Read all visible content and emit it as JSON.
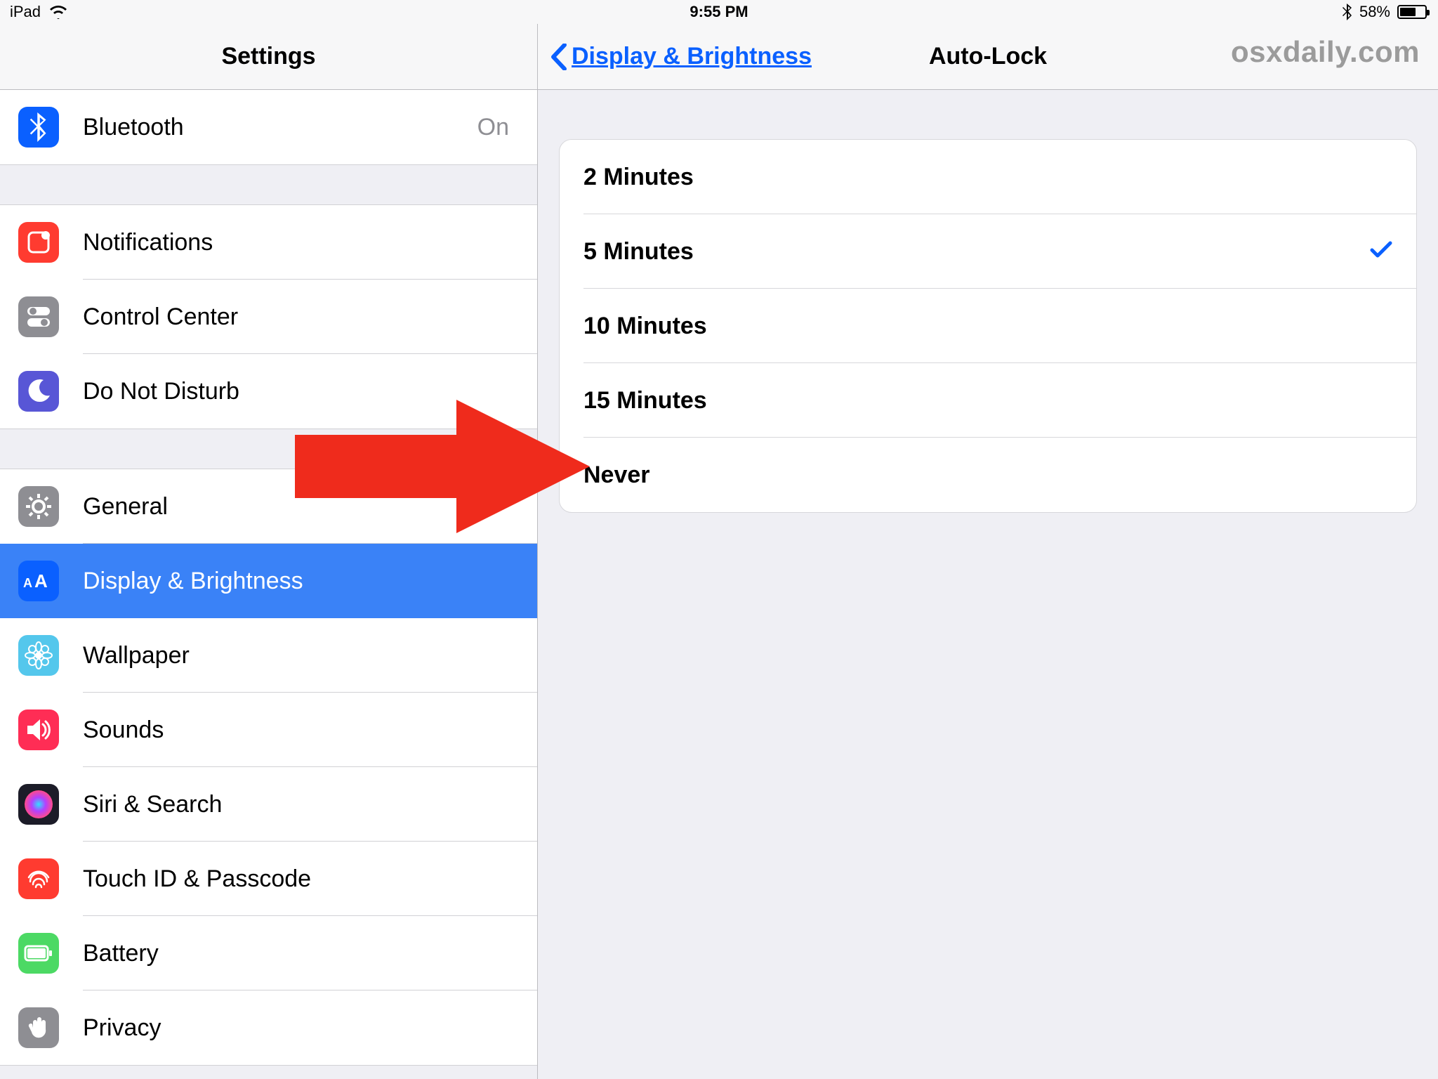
{
  "status": {
    "device": "iPad",
    "time": "9:55 PM",
    "battery_pct": "58%"
  },
  "left": {
    "title": "Settings",
    "groups": [
      {
        "rows": [
          {
            "key": "bluetooth",
            "label": "Bluetooth",
            "value": "On",
            "icon_bg": "#0a60ff",
            "icon": "bluetooth"
          }
        ]
      },
      {
        "rows": [
          {
            "key": "notifications",
            "label": "Notifications",
            "icon_bg": "#ff3b30",
            "icon": "notifications"
          },
          {
            "key": "control-center",
            "label": "Control Center",
            "icon_bg": "#8e8e93",
            "icon": "toggles"
          },
          {
            "key": "do-not-disturb",
            "label": "Do Not Disturb",
            "icon_bg": "#5856d6",
            "icon": "moon"
          }
        ]
      },
      {
        "rows": [
          {
            "key": "general",
            "label": "General",
            "icon_bg": "#8e8e93",
            "icon": "gear"
          },
          {
            "key": "display-brightness",
            "label": "Display & Brightness",
            "icon_bg": "#0a60ff",
            "icon": "aa",
            "selected": true
          },
          {
            "key": "wallpaper",
            "label": "Wallpaper",
            "icon_bg": "#54c7ec",
            "icon": "flower"
          },
          {
            "key": "sounds",
            "label": "Sounds",
            "icon_bg": "#ff2d55",
            "icon": "speaker"
          },
          {
            "key": "siri-search",
            "label": "Siri & Search",
            "icon_bg": "#1c1c28",
            "icon": "siri"
          },
          {
            "key": "touch-id-passcode",
            "label": "Touch ID & Passcode",
            "icon_bg": "#ff3b30",
            "icon": "fingerprint"
          },
          {
            "key": "battery",
            "label": "Battery",
            "icon_bg": "#4cd964",
            "icon": "battery"
          },
          {
            "key": "privacy",
            "label": "Privacy",
            "icon_bg": "#8e8e93",
            "icon": "hand"
          }
        ]
      }
    ]
  },
  "right": {
    "back_label": "Display & Brightness",
    "title": "Auto-Lock",
    "watermark": "osxdaily.com",
    "options": [
      {
        "label": "2 Minutes",
        "selected": false
      },
      {
        "label": "5 Minutes",
        "selected": true
      },
      {
        "label": "10 Minutes",
        "selected": false
      },
      {
        "label": "15 Minutes",
        "selected": false
      },
      {
        "label": "Never",
        "selected": false
      }
    ]
  }
}
